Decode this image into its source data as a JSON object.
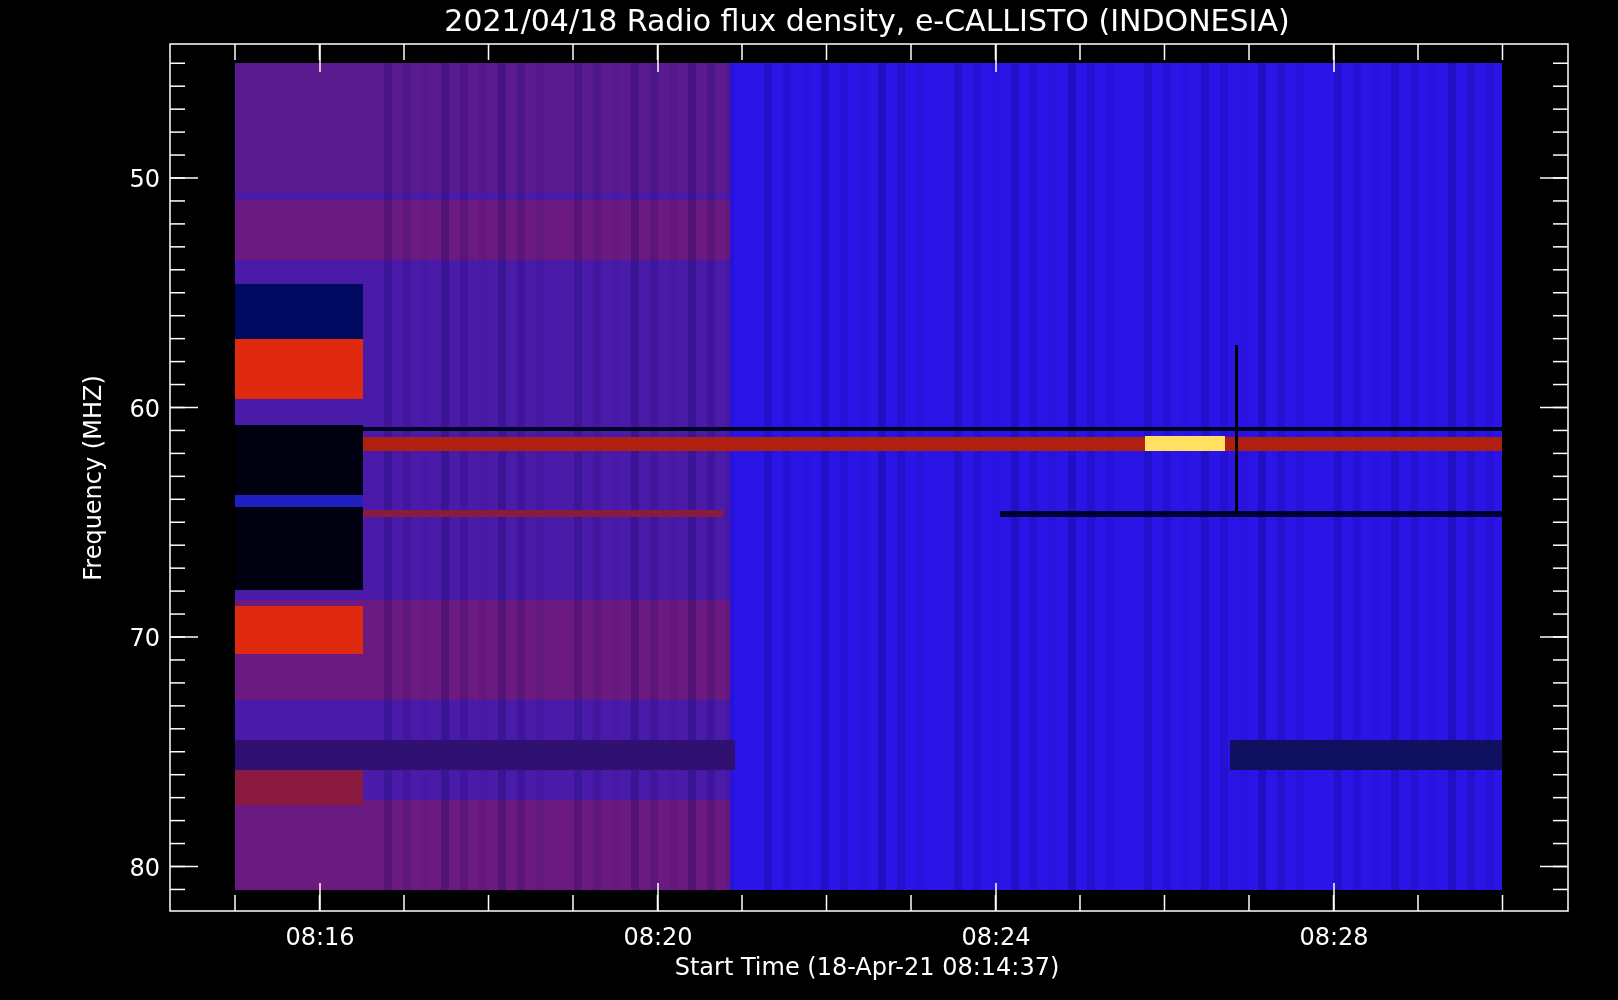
{
  "title": "2021/04/18  Radio flux density, e-CALLISTO (INDONESIA)",
  "y_axis": {
    "label": "Frequency (MHZ)",
    "ticks": [
      "50",
      "60",
      "70",
      "80"
    ]
  },
  "x_axis": {
    "label": "Start Time (18-Apr-21 08:14:37)",
    "ticks": [
      "08:16",
      "08:20",
      "08:24",
      "08:28"
    ]
  }
}
